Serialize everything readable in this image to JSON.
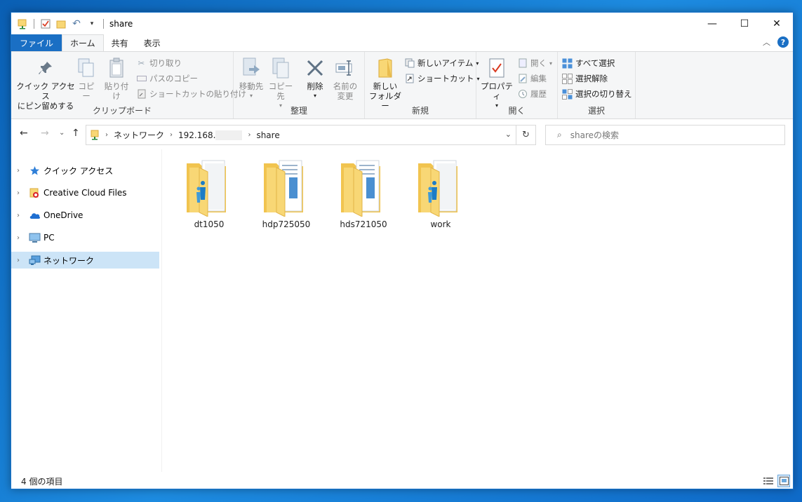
{
  "window": {
    "title": "share",
    "controls": {
      "minimize": "—",
      "maximize": "☐",
      "close": "✕"
    }
  },
  "ribbon_tabs": [
    {
      "label": "ファイル"
    },
    {
      "label": "ホーム"
    },
    {
      "label": "共有"
    },
    {
      "label": "表示"
    }
  ],
  "ribbon": {
    "clipboard": {
      "group_label": "クリップボード",
      "pin_line1": "クイック アクセス",
      "pin_line2": "にピン留めする",
      "copy": "コピー",
      "paste": "貼り付け",
      "cut": "切り取り",
      "copy_path": "パスのコピー",
      "paste_shortcut": "ショートカットの貼り付け"
    },
    "organize": {
      "group_label": "整理",
      "move_to": "移動先",
      "copy_to": "コピー先",
      "delete": "削除",
      "rename_line1": "名前の",
      "rename_line2": "変更"
    },
    "new": {
      "group_label": "新規",
      "new_folder_line1": "新しい",
      "new_folder_line2": "フォルダー",
      "new_item": "新しいアイテム",
      "shortcut": "ショートカット"
    },
    "open": {
      "group_label": "開く",
      "properties": "プロパティ",
      "open": "開く",
      "edit": "編集",
      "history": "履歴"
    },
    "select": {
      "group_label": "選択",
      "select_all": "すべて選択",
      "select_none": "選択解除",
      "invert": "選択の切り替え"
    }
  },
  "address": {
    "segments": [
      "ネットワーク",
      "192.168.",
      "share"
    ]
  },
  "search": {
    "placeholder": "shareの検索"
  },
  "nav_pane": [
    {
      "label": "クイック アクセス",
      "icon": "star-icon"
    },
    {
      "label": "Creative Cloud Files",
      "icon": "creative-cloud-icon"
    },
    {
      "label": "OneDrive",
      "icon": "cloud-icon"
    },
    {
      "label": "PC",
      "icon": "computer-icon"
    },
    {
      "label": "ネットワーク",
      "icon": "network-icon",
      "selected": true
    }
  ],
  "folders": [
    {
      "name": "dt1050",
      "type": "shared"
    },
    {
      "name": "hdp725050",
      "type": "documents"
    },
    {
      "name": "hds721050",
      "type": "documents"
    },
    {
      "name": "work",
      "type": "shared"
    }
  ],
  "status": {
    "item_count": "4 個の項目"
  },
  "colors": {
    "accent": "#1a6fc4",
    "selection": "#cce4f7",
    "folder": "#f8d775"
  }
}
